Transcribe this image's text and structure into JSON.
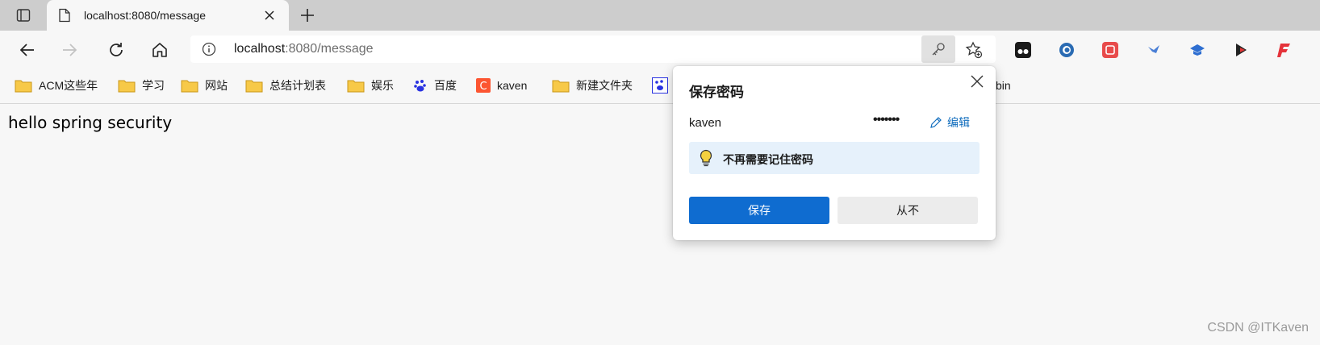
{
  "tabs": [
    {
      "title": "localhost:8080/message"
    }
  ],
  "address_bar": {
    "host": "localhost",
    "rest": ":8080/message"
  },
  "bookmarks": [
    {
      "label": "ACM这些年",
      "icon": "folder-icon"
    },
    {
      "label": "学习",
      "icon": "folder-icon"
    },
    {
      "label": "网站",
      "icon": "folder-icon"
    },
    {
      "label": "总结计划表",
      "icon": "folder-icon"
    },
    {
      "label": "娱乐",
      "icon": "folder-icon"
    },
    {
      "label": "百度",
      "icon": "baidu-icon"
    },
    {
      "label": "kaven",
      "icon": "csdn-icon"
    },
    {
      "label": "新建文件夹",
      "icon": "folder-icon"
    },
    {
      "label": "",
      "icon": "baidu-icon"
    },
    {
      "label": "bin",
      "icon": ""
    }
  ],
  "page": {
    "text": "hello spring security"
  },
  "save_password_popup": {
    "title": "保存密码",
    "username": "kaven",
    "password_mask": "•••••••",
    "edit_label": "编辑",
    "hint": "不再需要记住密码",
    "save_label": "保存",
    "never_label": "从不"
  },
  "watermark": "CSDN @ITKaven",
  "colors": {
    "accent": "#0f6cd0",
    "hint_background": "#e6f1fb",
    "tabstrip": "#cdcdcd"
  }
}
